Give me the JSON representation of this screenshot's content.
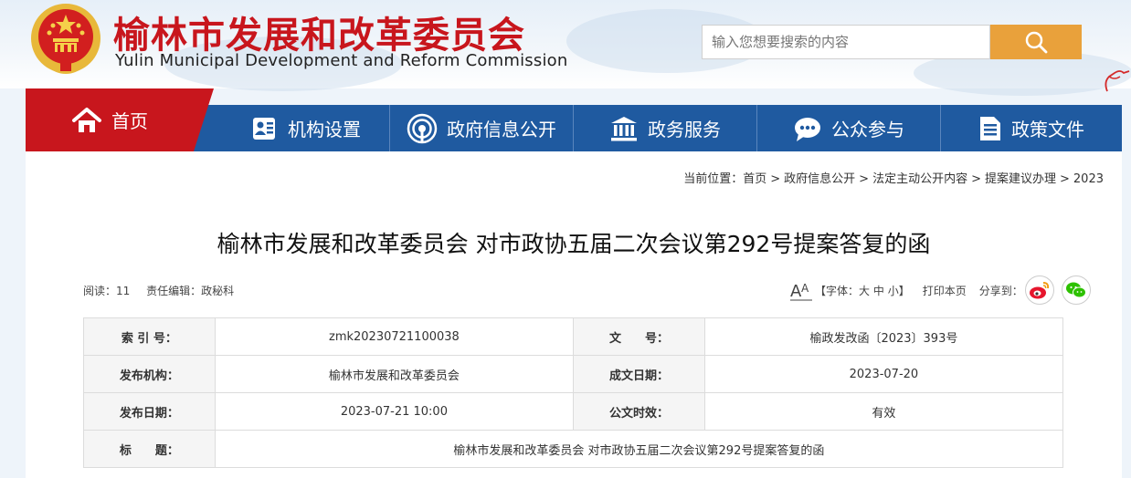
{
  "header": {
    "title_cn": "榆林市发展和改革委员会",
    "title_en": "Yulin Municipal Development and Reform Commission",
    "search_placeholder": "输入您想要搜索的内容",
    "brand_red": "#c8161d",
    "brand_blue": "#1f5aa0",
    "search_button_color": "#e9a13b"
  },
  "nav": {
    "home": {
      "label": "首页",
      "icon": "home-icon"
    },
    "items": [
      {
        "label": "机构设置",
        "icon": "id-card-icon"
      },
      {
        "label": "政府信息公开",
        "icon": "broadcast-icon"
      },
      {
        "label": "政务服务",
        "icon": "government-building-icon"
      },
      {
        "label": "公众参与",
        "icon": "chat-bubble-icon"
      },
      {
        "label": "政策文件",
        "icon": "document-icon"
      }
    ]
  },
  "breadcrumb": {
    "prefix": "当前位置：",
    "items": [
      "首页",
      "政府信息公开",
      "法定主动公开内容",
      "提案建议办理",
      "2023"
    ],
    "separator": ">"
  },
  "article": {
    "title": "榆林市发展和改革委员会 对市政协五届二次会议第292号提案答复的函",
    "reads": "阅读：11",
    "editor": "责任编辑：政秘科",
    "font_size_label": "【字体：",
    "font_size_options": [
      "大",
      "中",
      "小"
    ],
    "font_size_close": "】",
    "print_label": "打印本页",
    "share_label": "分享到："
  },
  "info_table": {
    "rows": [
      [
        {
          "key": "索 引 号：",
          "value": "zmk20230721100038"
        },
        {
          "key": "文　　号：",
          "value": "榆政发改函〔2023〕393号"
        }
      ],
      [
        {
          "key": "发布机构：",
          "value": "榆林市发展和改革委员会"
        },
        {
          "key": "成文日期：",
          "value": "2023-07-20"
        }
      ],
      [
        {
          "key": "发布日期：",
          "value": "2023-07-21 10:00"
        },
        {
          "key": "公文时效：",
          "value": "有效"
        }
      ]
    ],
    "title_row": {
      "key": "标　　题：",
      "value": "榆林市发展和改革委员会 对市政协五届二次会议第292号提案答复的函"
    }
  }
}
